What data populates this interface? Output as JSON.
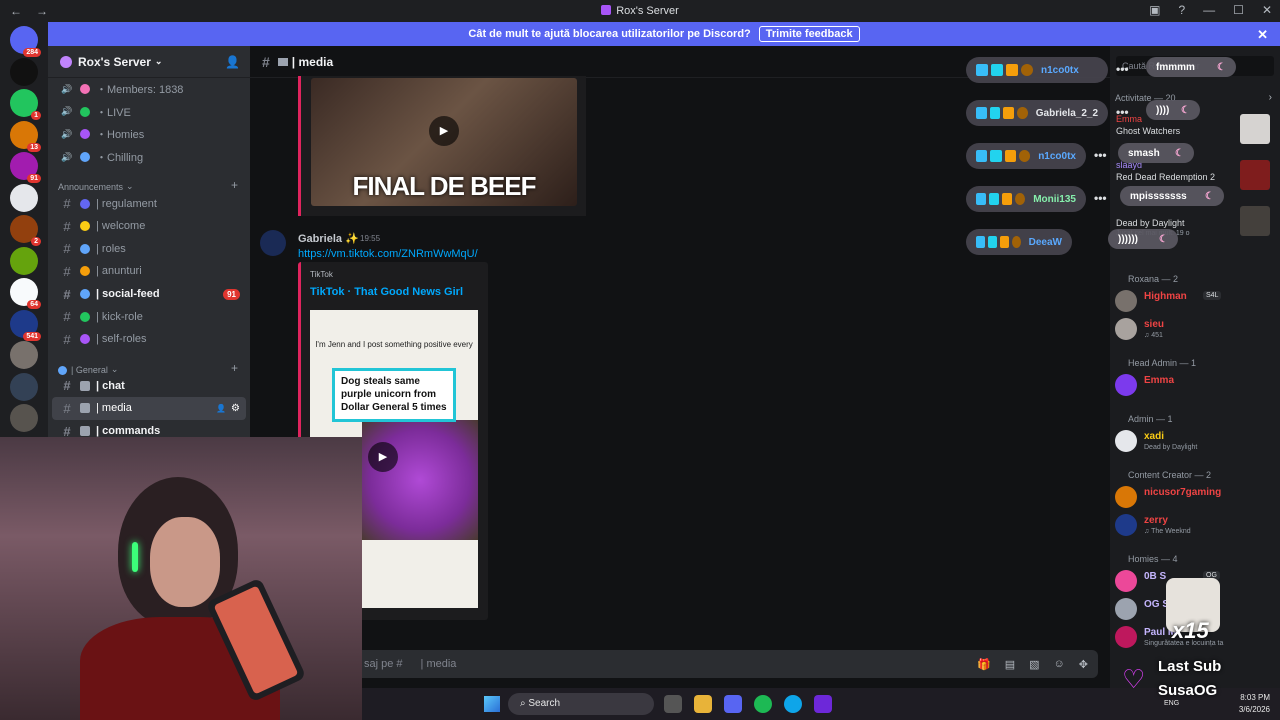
{
  "window": {
    "title": "Rox's Server",
    "back": "←",
    "forward": "→"
  },
  "banner": {
    "text": "Cât de mult te ajută blocarea utilizatorilor pe Discord?",
    "button": "Trimite feedback",
    "close": "✕"
  },
  "rail": {
    "servers": [
      {
        "badge": "284",
        "color": "#5865f2"
      },
      {
        "badge": "",
        "color": "#111"
      },
      {
        "badge": "1",
        "color": "#22c55e"
      },
      {
        "badge": "13",
        "color": "#d97706"
      },
      {
        "badge": "91",
        "color": "#a21caf"
      },
      {
        "badge": "",
        "color": "#e5e7eb"
      },
      {
        "badge": "2",
        "color": "#92400e"
      },
      {
        "badge": "",
        "color": "#65a30d"
      },
      {
        "badge": "64",
        "color": "#f8fafc"
      },
      {
        "badge": "541",
        "color": "#1e3a8a"
      },
      {
        "badge": "",
        "color": "#78716c"
      },
      {
        "badge": "",
        "color": "#334155"
      },
      {
        "badge": "",
        "color": "#57534e"
      }
    ]
  },
  "sidebar": {
    "server_name": "Rox's Server",
    "voice_channels": [
      {
        "label": "・Members: 1838",
        "color": "#f472b6"
      },
      {
        "label": "・LIVE",
        "color": "#22c55e"
      },
      {
        "label": "・Homies",
        "color": "#a855f7"
      },
      {
        "label": "・Chilling",
        "color": "#60a5fa"
      }
    ],
    "announcements_label": "Announcements",
    "announcement_channels": [
      {
        "label": "| regulament",
        "bold": false,
        "badge": ""
      },
      {
        "label": "| welcome",
        "bold": false,
        "badge": ""
      },
      {
        "label": "| roles",
        "bold": false,
        "badge": ""
      },
      {
        "label": "| anunturi",
        "bold": false,
        "badge": ""
      },
      {
        "label": "| social-feed",
        "bold": true,
        "badge": "91"
      },
      {
        "label": "| kick-role",
        "bold": false,
        "badge": ""
      },
      {
        "label": "| self-roles",
        "bold": false,
        "badge": ""
      }
    ],
    "general_label": "| General",
    "general_channels": [
      {
        "label": "| chat",
        "bold": true
      },
      {
        "label": "| media",
        "bold": false
      },
      {
        "label": "| commands",
        "bold": true
      }
    ]
  },
  "main": {
    "channel": "| media",
    "thumb_caption": "FINAL DE BEEF",
    "message": {
      "author": "Gabriela ✨",
      "time": "19:55",
      "link": "https://vm.tiktok.com/ZNRmWwMqU/",
      "embed_provider": "TikTok",
      "embed_title": "TikTok · That Good News Girl",
      "video_caption": "I'm Jenn and I post something positive every",
      "video_card": "Dog steals same purple unicorn from Dollar General 5 times"
    },
    "composer_placeholder": "saj pe #",
    "composer_channel": "| media"
  },
  "overlay": {
    "users": [
      {
        "name": "n1co0tx",
        "color": "#5aa9ff"
      },
      {
        "name": "Gabriela_2_2",
        "color": "#e5e7eb"
      },
      {
        "name": "n1co0tx",
        "color": "#5aa9ff"
      },
      {
        "name": "Monii135",
        "color": "#86efac"
      },
      {
        "name": "DeeaW",
        "color": "#5aa9ff"
      }
    ],
    "right_pills": [
      "fmmmm",
      "))))",
      "smash",
      "mpisssssss",
      "))))))"
    ]
  },
  "members": {
    "search_placeholder": "Caută Rox's Server",
    "activity_label": "Activitate — 20",
    "activity": [
      {
        "name": "Emma",
        "game": "Ghost Watchers",
        "color": "#ef4444"
      },
      {
        "name": "slaayd",
        "game": "Red Dead Redemption 2",
        "color": "#a78bfa"
      },
      {
        "name": "",
        "game": "Dead by Daylight",
        "color": "#ef4444",
        "note": "Jucat cel mai mult: 19 o"
      }
    ],
    "sections": [
      {
        "title": "Roxana — 2",
        "people": [
          {
            "name": "Highman",
            "tag": "S4L",
            "color": "#ef4444",
            "sub": ""
          },
          {
            "name": "sieu",
            "color": "#ef4444",
            "sub": "♫ 451"
          }
        ]
      },
      {
        "title": "Head Admin — 1",
        "people": [
          {
            "name": "Emma",
            "color": "#ef4444",
            "sub": ""
          }
        ]
      },
      {
        "title": "Admin — 1",
        "people": [
          {
            "name": "xadi",
            "color": "#facc15",
            "sub": "Dead by Daylight"
          }
        ]
      },
      {
        "title": "Content Creator — 2",
        "people": [
          {
            "name": "nicusor7gaming",
            "color": "#ef4444",
            "sub": ""
          },
          {
            "name": "zerry",
            "color": "#ef4444",
            "sub": "♫ The Weeknd"
          }
        ]
      },
      {
        "title": "Homies — 4",
        "people": [
          {
            "name": "0B S",
            "tag": "OG",
            "color": "#c4b5fd",
            "sub": ""
          },
          {
            "name": "OG S",
            "tag": "OG",
            "color": "#c4b5fd",
            "sub": ""
          },
          {
            "name": "Paul M",
            "color": "#c4b5fd",
            "sub": "Singurătatea e locuința ta"
          }
        ]
      }
    ]
  },
  "taskbar": {
    "search": "Search",
    "lang": "ENG",
    "time": "8:03 PM",
    "date": "3/6/2026"
  },
  "lastsub": {
    "count": "x15",
    "label": "Last Sub",
    "name": "SusaOG"
  }
}
